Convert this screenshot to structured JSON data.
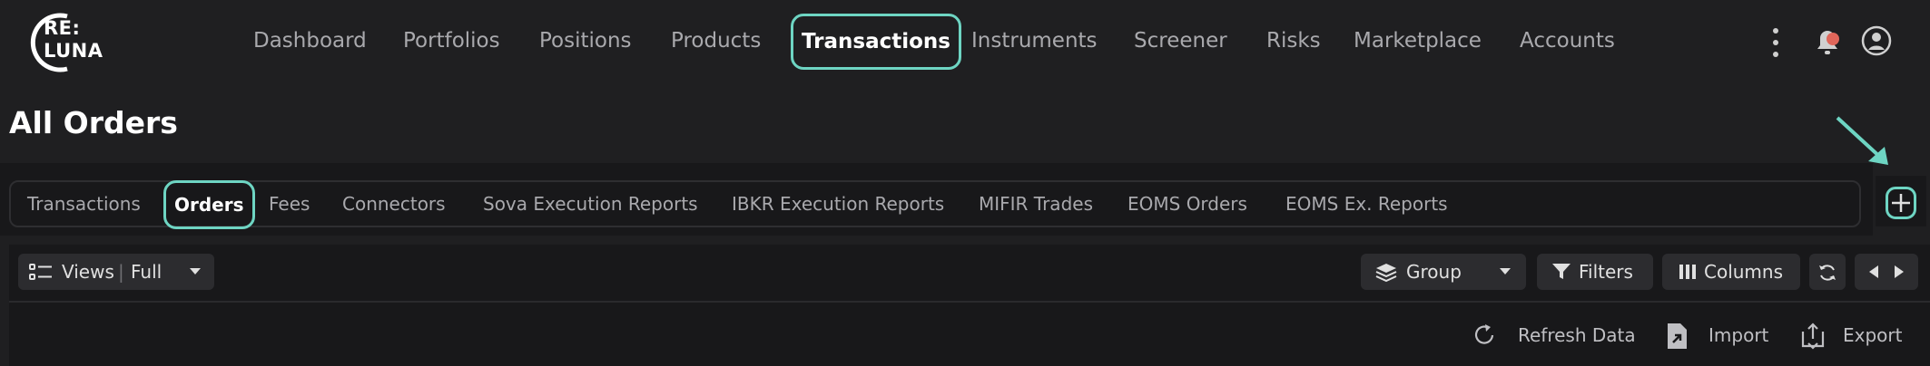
{
  "app": {
    "logo_line1": "RE:",
    "logo_line2": "LUNA"
  },
  "nav": {
    "items": [
      {
        "label": "Dashboard"
      },
      {
        "label": "Portfolios"
      },
      {
        "label": "Positions"
      },
      {
        "label": "Products"
      },
      {
        "label": "Transactions",
        "active": true
      },
      {
        "label": "Instruments"
      },
      {
        "label": "Screener"
      },
      {
        "label": "Risks"
      },
      {
        "label": "Marketplace"
      },
      {
        "label": "Accounts"
      }
    ],
    "icons": [
      "more-vertical-icon",
      "bell-icon",
      "user-avatar-icon"
    ],
    "notification_dot_color": "#e0665a"
  },
  "page": {
    "title": "All Orders"
  },
  "subtabs": {
    "items": [
      {
        "label": "Transactions"
      },
      {
        "label": "Orders",
        "active": true
      },
      {
        "label": "Fees"
      },
      {
        "label": "Connectors"
      },
      {
        "label": "Sova Execution Reports"
      },
      {
        "label": "IBKR Execution Reports"
      },
      {
        "label": "MIFIR Trades"
      },
      {
        "label": "EOMS Orders"
      },
      {
        "label": "EOMS Ex. Reports"
      }
    ],
    "add_icon": "plus-icon"
  },
  "toolbar": {
    "views_label": "Views",
    "views_value": "Full",
    "group_label": "Group",
    "filters_label": "Filters",
    "columns_label": "Columns",
    "refresh_data_label": "Refresh Data",
    "import_label": "Import",
    "export_label": "Export"
  },
  "colors": {
    "accent": "#6ed5c3",
    "background": "#1f1f21",
    "panel": "#18181a"
  }
}
